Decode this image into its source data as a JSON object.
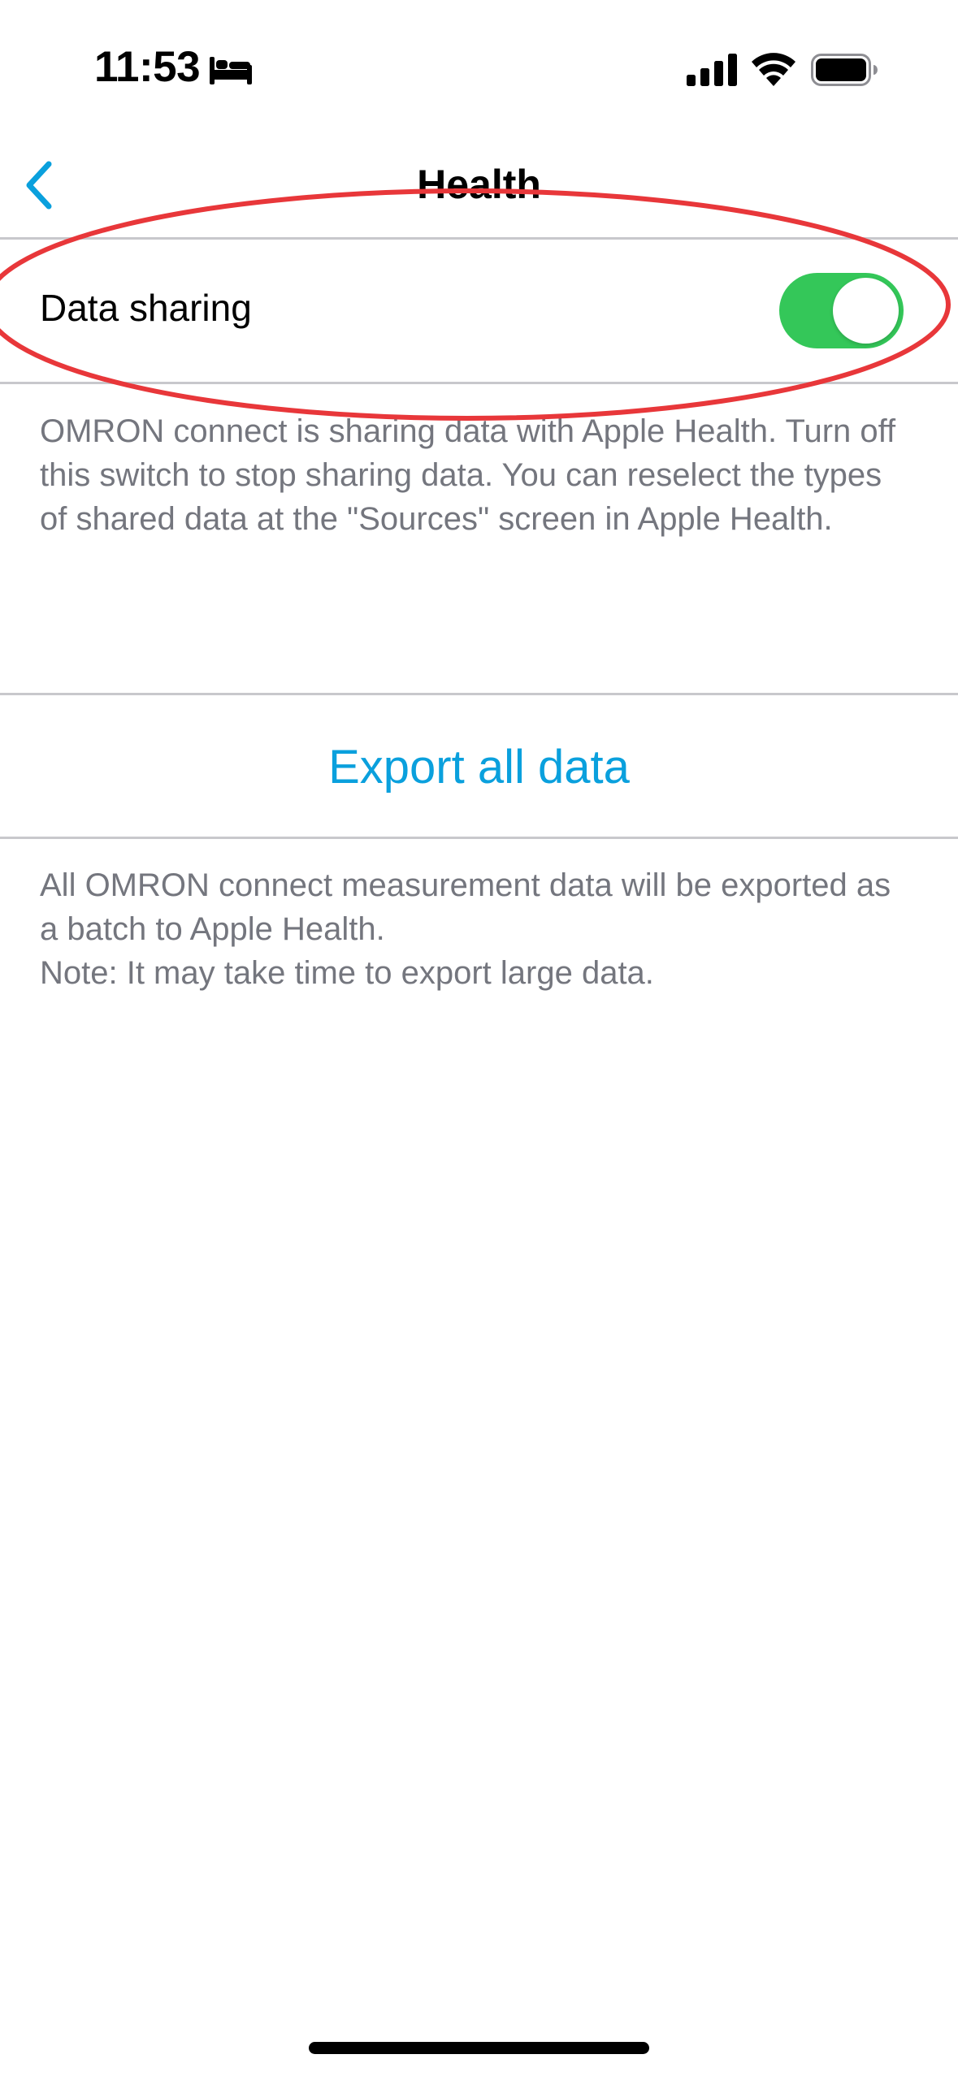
{
  "status_bar": {
    "time": "11:53",
    "focus_icon": "bed-icon",
    "signal_icon": "cellular-signal-icon",
    "wifi_icon": "wifi-icon",
    "battery_icon": "battery-icon"
  },
  "nav": {
    "back_icon": "chevron-left-icon",
    "title": "Health"
  },
  "data_sharing": {
    "label": "Data sharing",
    "enabled": true,
    "description": "OMRON connect is sharing data with Apple Health. Turn off this switch to stop sharing data. You can reselect the types of shared data at the \"Sources\" screen in Apple Health."
  },
  "export": {
    "label": "Export all data",
    "description_line1": "All OMRON connect measurement data will be exported as a batch to Apple Health.",
    "description_line2": "Note: It may take time to export large data."
  },
  "colors": {
    "accent": "#0aa0dd",
    "switch_on": "#34c759",
    "secondary_text": "#74767e",
    "annotation": "#e8373a"
  }
}
